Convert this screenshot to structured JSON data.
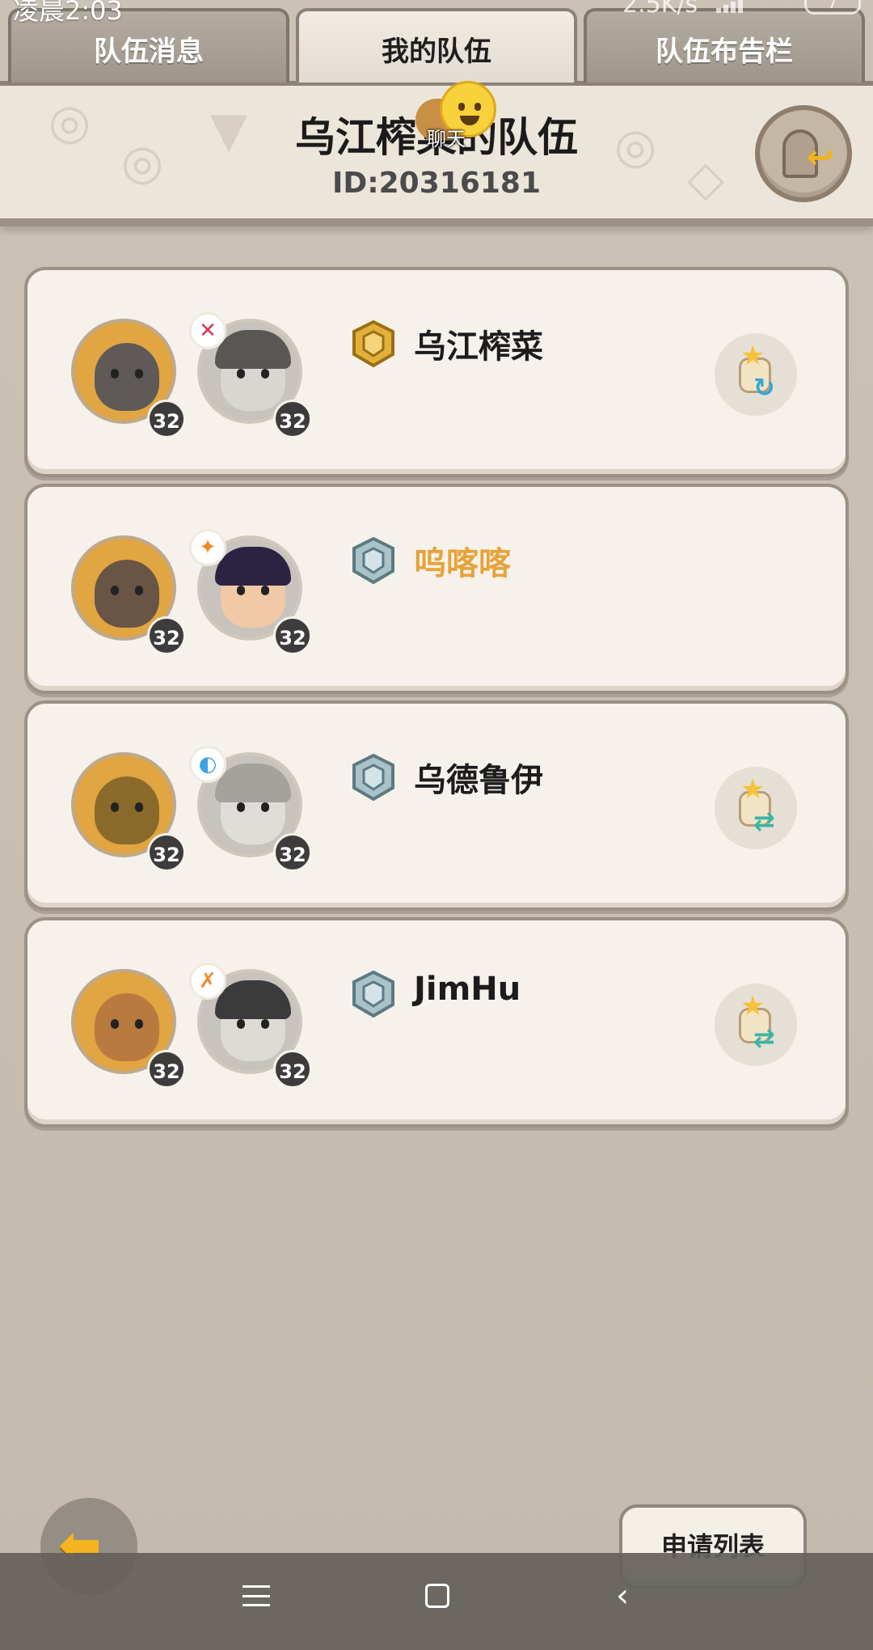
{
  "status_bar": {
    "time": "凌晨2:03",
    "net_speed": "2.5K/s",
    "battery": "7"
  },
  "tabs": [
    {
      "label": "队伍消息",
      "active": false
    },
    {
      "label": "我的队伍",
      "active": true
    },
    {
      "label": "队伍布告栏",
      "active": false
    }
  ],
  "team": {
    "name": "乌江榨菜的队伍",
    "id_text": "ID:20316181"
  },
  "chat": {
    "label": "聊天"
  },
  "members": [
    {
      "name": "乌江榨菜",
      "pet_level": "32",
      "hero_level": "32",
      "rank": "gold",
      "name_color": "#1c1c1c",
      "action": "transfer-leader"
    },
    {
      "name": "呜喀喀",
      "pet_level": "32",
      "hero_level": "32",
      "rank": "silver",
      "name_color": "#e6a33a",
      "action": ""
    },
    {
      "name": "乌德鲁伊",
      "pet_level": "32",
      "hero_level": "32",
      "rank": "silver",
      "name_color": "#1c1c1c",
      "action": "swap"
    },
    {
      "name": "JimHu",
      "pet_level": "32",
      "hero_level": "32",
      "rank": "silver",
      "name_color": "#1c1c1c",
      "action": "swap"
    }
  ],
  "bottom": {
    "apply_list_label": "申请列表"
  },
  "colors": {
    "accent_gold": "#f5b41f",
    "highlight_name": "#e6a33a",
    "card_bg": "#f6f1ea",
    "page_bg": "#c7bdb0"
  }
}
